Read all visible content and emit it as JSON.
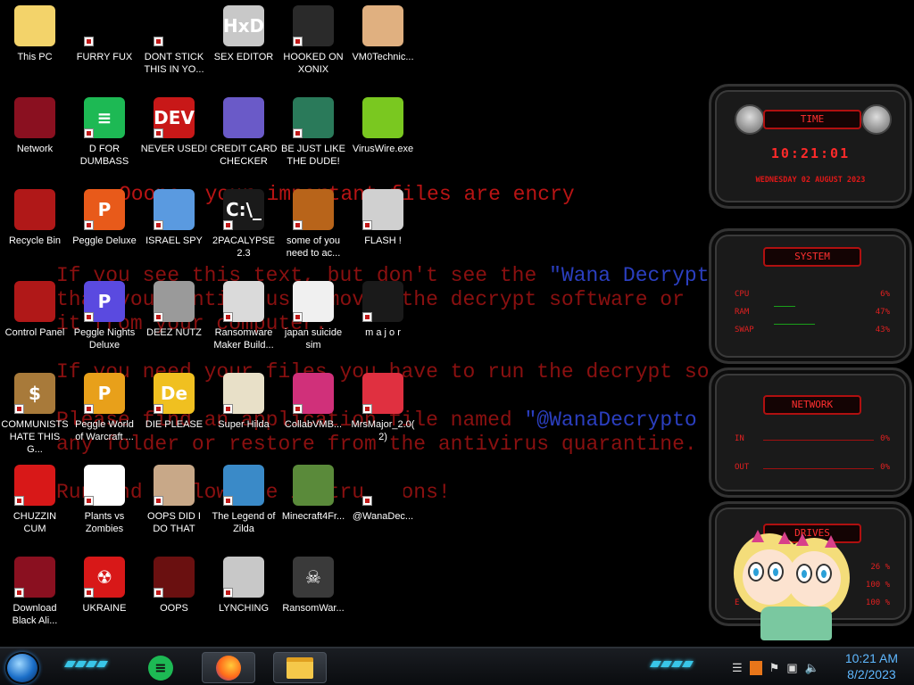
{
  "wallpaper": {
    "line1": "Ooops, your important files are encry",
    "line2a": "If you see this text, but don't see the ",
    "line2b": "\"Wana Decrypt",
    "line3": "that your antivirus removed the decrypt software or",
    "line4": "it from your computer.",
    "line5": "If you need your files you have to run the decrypt so",
    "line6a": "Please find an application file named ",
    "line6b": "\"@WanaDecrypto",
    "line7": "any folder or restore from the antivirus quarantine.",
    "line8": "Run and follow the instructions!"
  },
  "icons": [
    {
      "label": "This PC",
      "glyph": "",
      "color": "#f3d36a",
      "shortcut": false,
      "icon": "cartoon-face-icon"
    },
    {
      "label": "FURRY FUX",
      "glyph": "",
      "color": "#000000",
      "shortcut": true,
      "icon": "vlc-cone-icon"
    },
    {
      "label": "DONT STICK THIS IN YO...",
      "glyph": "",
      "color": "#000000",
      "shortcut": true,
      "icon": "vlc-cone-icon"
    },
    {
      "label": "SEX EDITOR",
      "glyph": "HxD",
      "color": "#c8c8c8",
      "shortcut": false,
      "icon": "hex-editor-icon"
    },
    {
      "label": "HOOKED ON XONIX",
      "glyph": "",
      "color": "#2a2a2a",
      "shortcut": true,
      "icon": "xonix-game-icon"
    },
    {
      "label": "VM0Technic...",
      "glyph": "",
      "color": "#e0b080",
      "shortcut": false,
      "icon": "doctor-avatar-icon"
    },
    {
      "label": "Network",
      "glyph": "",
      "color": "#8a1020",
      "shortcut": false,
      "icon": "alien-orb-icon"
    },
    {
      "label": "D FOR DUMBASS",
      "glyph": "≡",
      "color": "#1db954",
      "shortcut": true,
      "icon": "spotify-icon"
    },
    {
      "label": "NEVER USED!",
      "glyph": "DEV",
      "color": "#c81818",
      "shortcut": true,
      "icon": "devcpp-icon"
    },
    {
      "label": "CREDIT CARD CHECKER",
      "glyph": "",
      "color": "#6a5ac8",
      "shortcut": false,
      "icon": "credit-card-icon"
    },
    {
      "label": "BE JUST LIKE THE DUDE!",
      "glyph": "",
      "color": "#2a7a5a",
      "shortcut": true,
      "icon": "santa-dude-icon"
    },
    {
      "label": "VirusWire.exe",
      "glyph": "",
      "color": "#7ac820",
      "shortcut": false,
      "icon": "lime-slice-icon"
    },
    {
      "label": "Recycle Bin",
      "glyph": "",
      "color": "#b01818",
      "shortcut": false,
      "icon": "recycle-bin-icon"
    },
    {
      "label": "Peggle Deluxe",
      "glyph": "P",
      "color": "#e85a1a",
      "shortcut": true,
      "icon": "peggle-icon"
    },
    {
      "label": "ISRAEL SPY",
      "glyph": "",
      "color": "#5a9ae0",
      "shortcut": true,
      "icon": "network-spy-icon"
    },
    {
      "label": "2PACALYPSE 2.3",
      "glyph": "C:\\_",
      "color": "#1a1a1a",
      "shortcut": true,
      "icon": "console-icon"
    },
    {
      "label": "some of you need to ac...",
      "glyph": "",
      "color": "#b8641a",
      "shortcut": true,
      "icon": "dog-icon"
    },
    {
      "label": "FLASH !",
      "glyph": "",
      "color": "#d0d0d0",
      "shortcut": true,
      "icon": "flash-icon"
    },
    {
      "label": "Control Panel",
      "glyph": "",
      "color": "#b01818",
      "shortcut": false,
      "icon": "control-panel-icon"
    },
    {
      "label": "Peggle Nights Deluxe",
      "glyph": "P",
      "color": "#5a4ae0",
      "shortcut": true,
      "icon": "peggle-icon"
    },
    {
      "label": "DEEZ NUTZ",
      "glyph": "",
      "color": "#9a9a9a",
      "shortcut": true,
      "icon": "stacked-windows-icon"
    },
    {
      "label": "Ransomware Maker Build...",
      "glyph": "",
      "color": "#dadada",
      "shortcut": true,
      "icon": "window-app-icon"
    },
    {
      "label": "japan suicide sim",
      "glyph": "",
      "color": "#f0f0f0",
      "shortcut": true,
      "icon": "file-icon"
    },
    {
      "label": "m a j o r",
      "glyph": "",
      "color": "#1a1a1a",
      "shortcut": true,
      "icon": "vinyl-record-icon"
    },
    {
      "label": "COMMUNISTS HATE THIS G...",
      "glyph": "$",
      "color": "#a87a3a",
      "shortcut": true,
      "icon": "money-bag-icon"
    },
    {
      "label": "Peggle World of Warcraft ...",
      "glyph": "P",
      "color": "#e8a01a",
      "shortcut": true,
      "icon": "peggle-icon"
    },
    {
      "label": "DIE PLEASE",
      "glyph": "De",
      "color": "#f0c020",
      "shortcut": true,
      "icon": "de-app-icon"
    },
    {
      "label": "Super Hilda",
      "glyph": "",
      "color": "#e8e0c8",
      "shortcut": true,
      "icon": "pixel-cat-icon"
    },
    {
      "label": "CollabVMB...",
      "glyph": "",
      "color": "#d0307a",
      "shortcut": true,
      "icon": "collab-vm-icon"
    },
    {
      "label": "MrsMajor_2.0(2)",
      "glyph": "",
      "color": "#e03040",
      "shortcut": true,
      "icon": "file-red-icon"
    },
    {
      "label": "CHUZZIN CUM",
      "glyph": "",
      "color": "#d81818",
      "shortcut": true,
      "icon": "chuzzle-icon"
    },
    {
      "label": "Plants vs Zombies",
      "glyph": "",
      "color": "#ffffff",
      "shortcut": true,
      "icon": "flower-icon"
    },
    {
      "label": "OOPS DID I DO THAT",
      "glyph": "",
      "color": "#c8a888",
      "shortcut": true,
      "icon": "portrait-icon"
    },
    {
      "label": "The Legend of Zilda",
      "glyph": "",
      "color": "#3a8ac8",
      "shortcut": true,
      "icon": "pixel-hero-icon"
    },
    {
      "label": "Minecraft4Fr...",
      "glyph": "",
      "color": "#5a8a3a",
      "shortcut": false,
      "icon": "minecraft-block-icon"
    },
    {
      "label": "@WanaDec...",
      "glyph": "",
      "color": "#000000",
      "shortcut": true,
      "icon": "wannacry-icon"
    },
    {
      "label": "Download Black Ali...",
      "glyph": "",
      "color": "#8a1020",
      "shortcut": true,
      "icon": "alien-orb-icon"
    },
    {
      "label": "UKRAINE",
      "glyph": "☢",
      "color": "#d81818",
      "shortcut": true,
      "icon": "radiation-icon"
    },
    {
      "label": "OOPS",
      "glyph": "",
      "color": "#6a1010",
      "shortcut": true,
      "icon": "dark-app-icon"
    },
    {
      "label": "LYNCHING",
      "glyph": "",
      "color": "#c8c8c8",
      "shortcut": true,
      "icon": "crest-icon"
    },
    {
      "label": "RansomWar...",
      "glyph": "☠",
      "color": "#3a3a3a",
      "shortcut": false,
      "icon": "skull-icon"
    }
  ],
  "gadgets": {
    "time": {
      "title": "TIME",
      "time": "10:21:01",
      "date": "WEDNESDAY 02 AUGUST 2023"
    },
    "system": {
      "title": "SYSTEM",
      "rows": [
        {
          "label": "CPU",
          "value": "6%"
        },
        {
          "label": "RAM",
          "value": "47%"
        },
        {
          "label": "SWAP",
          "value": "43%"
        }
      ]
    },
    "network": {
      "title": "NETWORK",
      "rows": [
        {
          "label": "IN",
          "value": "0%"
        },
        {
          "label": "OUT",
          "value": "0%"
        }
      ]
    },
    "drives": {
      "title": "DRIVES",
      "rows": [
        {
          "label": "",
          "value": "26 %"
        },
        {
          "label": "F",
          "value": "100 %"
        },
        {
          "label": "E",
          "value": "100 %"
        }
      ]
    }
  },
  "taskbar": {
    "pinned": [
      "spotify-icon",
      "firefox-icon",
      "file-explorer-icon"
    ],
    "clock_time": "10:21 AM",
    "clock_date": "8/2/2023"
  },
  "colors": {
    "accent": "#39c6e8",
    "alert": "#e01818",
    "wallpaper_text": "#8a1010"
  }
}
